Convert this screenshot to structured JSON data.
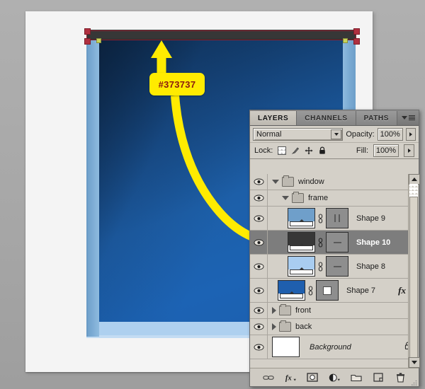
{
  "annotation": {
    "color_label": "#373737",
    "callout_bg": "#ffeb00",
    "callout_text_color": "#8a1a10",
    "arrow_color": "#ffeb00",
    "arrow_name": "curved-pointer-arrow"
  },
  "canvas": {
    "window_topbar_color": "#373737",
    "window_glass_color": "#1c5fae",
    "window_frame_color": "#79a9d2",
    "window_sill_color": "#aed0ef",
    "document_bg": "#f4f4f4",
    "workspace_bg": "#a8a8a8"
  },
  "panel": {
    "tabs": [
      {
        "label": "LAYERS",
        "active": true
      },
      {
        "label": "CHANNELS",
        "active": false
      },
      {
        "label": "PATHS",
        "active": false
      }
    ],
    "menu_icon": "panel-menu-icon",
    "blend_mode": "Normal",
    "opacity_label": "Opacity:",
    "opacity_value": "100%",
    "fill_label": "Fill:",
    "fill_value": "100%",
    "lock_label": "Lock:",
    "lock_icons": [
      "lock-transparency-icon",
      "lock-image-pixels-icon",
      "lock-position-icon",
      "lock-all-icon"
    ],
    "layers": [
      {
        "name": "window",
        "type": "group",
        "expanded": true,
        "indent": 0,
        "visible": true,
        "selected": false
      },
      {
        "name": "frame",
        "type": "group",
        "expanded": true,
        "indent": 1,
        "visible": true,
        "selected": false
      },
      {
        "name": "Shape 9",
        "type": "shape",
        "indent": 2,
        "visible": true,
        "selected": false,
        "thumb_color": "#6f9fca",
        "mask_glyph": "bars",
        "has_link": true
      },
      {
        "name": "Shape 10",
        "type": "shape",
        "indent": 2,
        "visible": true,
        "selected": true,
        "thumb_color": "#373737",
        "mask_glyph": "dash",
        "has_link": true
      },
      {
        "name": "Shape 8",
        "type": "shape",
        "indent": 2,
        "visible": true,
        "selected": false,
        "thumb_color": "#a9cdf0",
        "mask_glyph": "dash",
        "has_link": true
      },
      {
        "name": "Shape 7",
        "type": "shape",
        "indent": 1,
        "visible": true,
        "selected": false,
        "thumb_color": "#1f5fae",
        "mask_glyph": "square",
        "has_link": true,
        "fx_label": "fx",
        "has_fx": true
      },
      {
        "name": "front",
        "type": "group",
        "expanded": false,
        "indent": 0,
        "visible": true,
        "selected": false
      },
      {
        "name": "back",
        "type": "group",
        "expanded": false,
        "indent": 0,
        "visible": true,
        "selected": false
      },
      {
        "name": "Background",
        "type": "background",
        "indent": 0,
        "visible": true,
        "selected": false,
        "italic": true,
        "locked": true,
        "thumb_color": "#ffffff"
      }
    ],
    "bottom_tools": [
      "link-layers-icon",
      "layer-style-fx-icon",
      "add-layer-mask-icon",
      "adjustment-layer-icon",
      "new-group-icon",
      "new-layer-icon",
      "delete-layer-icon"
    ],
    "scrollbar": {
      "up_icon": "scroll-up-icon",
      "down_icon": "scroll-down-icon"
    }
  }
}
